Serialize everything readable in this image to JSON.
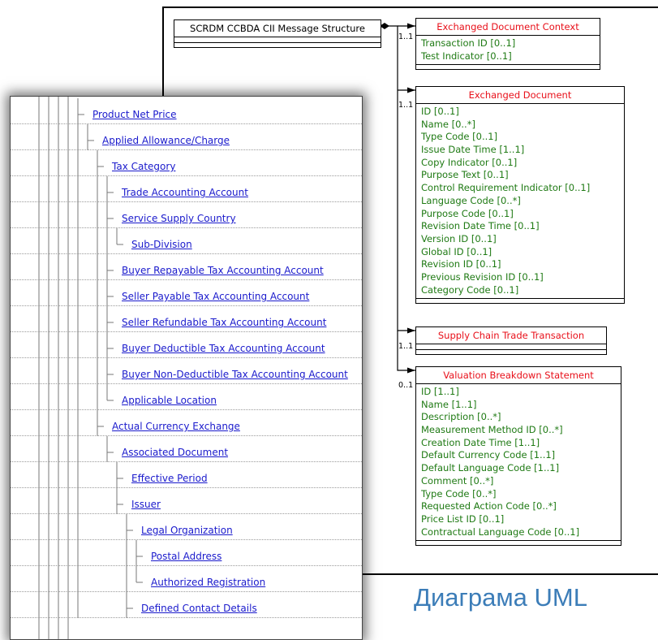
{
  "colors": {
    "link": "#1a1acc",
    "attribute": "#1f7a14",
    "class_name_red": "#e8101a",
    "caption": "#3c7db8"
  },
  "uml": {
    "root_class": "SCRDM CCBDA CII Message Structure",
    "classes": [
      {
        "name": "Exchanged Document Context",
        "multiplicity": "1..1",
        "attributes": [
          "Transaction ID [0..1]",
          "Test Indicator [0..1]"
        ]
      },
      {
        "name": "Exchanged Document",
        "multiplicity": "1..1",
        "attributes": [
          "ID [0..1]",
          "Name [0..*]",
          "Type Code [0..1]",
          "Issue Date Time [1..1]",
          "Copy Indicator [0..1]",
          "Purpose Text [0..1]",
          "Control Requirement Indicator [0..1]",
          "Language Code [0..*]",
          "Purpose Code [0..1]",
          "Revision Date Time [0..1]",
          "Version ID [0..1]",
          "Global ID [0..1]",
          "Revision ID [0..1]",
          "Previous Revision ID [0..1]",
          "Category Code [0..1]"
        ]
      },
      {
        "name": "Supply Chain Trade Transaction",
        "multiplicity": "1..1",
        "attributes": []
      },
      {
        "name": "Valuation Breakdown Statement",
        "multiplicity": "0..1",
        "attributes": [
          "ID [1..1]",
          "Name [1..1]",
          "Description [0..*]",
          "Measurement Method ID [0..*]",
          "Creation Date Time [1..1]",
          "Default Currency Code [1..1]",
          "Default Language Code [1..1]",
          "Comment [0..*]",
          "Type Code [0..*]",
          "Requested Action Code [0..*]",
          "Price List ID [0..1]",
          "Contractual Language Code [0..1]"
        ]
      }
    ]
  },
  "tree": {
    "items": [
      {
        "label": "Product Net Price",
        "depth": 0,
        "last": false
      },
      {
        "label": "Applied Allowance/Charge",
        "depth": 1,
        "last": false
      },
      {
        "label": "Tax Category",
        "depth": 2,
        "last": false
      },
      {
        "label": "Trade Accounting Account",
        "depth": 3,
        "last": false
      },
      {
        "label": "Service Supply Country",
        "depth": 3,
        "last": false
      },
      {
        "label": "Sub-Division",
        "depth": 4,
        "last": true
      },
      {
        "label": "Buyer Repayable Tax Accounting Account",
        "depth": 3,
        "last": false
      },
      {
        "label": "Seller Payable Tax Accounting Account",
        "depth": 3,
        "last": false
      },
      {
        "label": "Seller Refundable Tax Accounting Account",
        "depth": 3,
        "last": false
      },
      {
        "label": "Buyer Deductible Tax Accounting Account",
        "depth": 3,
        "last": false
      },
      {
        "label": "Buyer Non-Deductible Tax Accounting Account",
        "depth": 3,
        "last": false
      },
      {
        "label": "Applicable Location",
        "depth": 3,
        "last": true
      },
      {
        "label": "Actual Currency Exchange",
        "depth": 2,
        "last": false
      },
      {
        "label": "Associated Document",
        "depth": 3,
        "last": false
      },
      {
        "label": "Effective Period",
        "depth": 4,
        "last": false
      },
      {
        "label": "Issuer",
        "depth": 4,
        "last": false
      },
      {
        "label": "Legal Organization",
        "depth": 5,
        "last": false
      },
      {
        "label": "Postal Address",
        "depth": 6,
        "last": false
      },
      {
        "label": "Authorized Registration",
        "depth": 6,
        "last": true
      },
      {
        "label": "Defined Contact Details",
        "depth": 5,
        "last": false
      }
    ]
  },
  "caption": "Диаграма UML"
}
